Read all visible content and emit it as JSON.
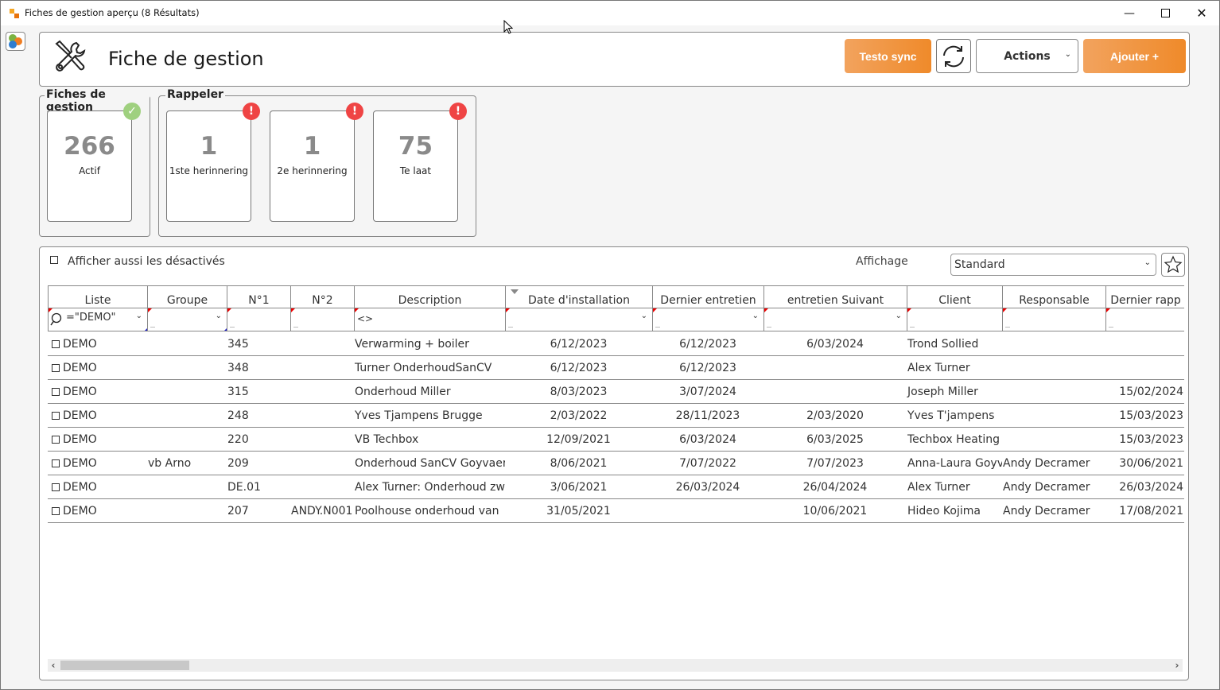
{
  "window": {
    "title": "Fiches de gestion aperçu (8 Résultats)",
    "controls": {
      "minimize": "—",
      "maximize": "☐",
      "close": "✕"
    }
  },
  "header": {
    "icon": "tools-icon",
    "title": "Fiche de gestion",
    "buttons": {
      "testo_sync": "Testo sync",
      "refresh": "refresh-icon",
      "actions": "Actions",
      "add": "Ajouter +"
    }
  },
  "colors": {
    "accent_orange": "#ef8a2a",
    "badge_ok": "#9fd07f",
    "badge_alert": "#ef4444",
    "filter_mark": "#e00000"
  },
  "stats": {
    "fiches": {
      "title": "Fiches de gestion",
      "cards": [
        {
          "value": "266",
          "label": "Actif",
          "badge": "check"
        }
      ]
    },
    "rappeler": {
      "title": "Rappeler",
      "cards": [
        {
          "value": "1",
          "label": "1ste herinnering",
          "badge": "!"
        },
        {
          "value": "1",
          "label": "2e herinnering",
          "badge": "!"
        },
        {
          "value": "75",
          "label": "Te laat",
          "badge": "!"
        }
      ]
    }
  },
  "list": {
    "show_disabled_label": "Afficher aussi les désactivés",
    "show_disabled_checked": false,
    "affichage_label": "Affichage",
    "affichage_value": "Standard",
    "columns": [
      {
        "label": "Liste",
        "filter": "=\"DEMO\"",
        "filter_type": "search-select"
      },
      {
        "label": "Groupe",
        "filter": "",
        "filter_type": "select"
      },
      {
        "label": "N°1",
        "filter": "",
        "filter_type": "text"
      },
      {
        "label": "N°2",
        "filter": "",
        "filter_type": "text"
      },
      {
        "label": "Description",
        "filter": "<>",
        "filter_type": "text"
      },
      {
        "label": "Date d'installation",
        "filter": "",
        "filter_type": "select",
        "sorted": "desc"
      },
      {
        "label": "Dernier entretien",
        "filter": "",
        "filter_type": "select"
      },
      {
        "label": "entretien Suivant",
        "filter": "",
        "filter_type": "select"
      },
      {
        "label": "Client",
        "filter": "",
        "filter_type": "text"
      },
      {
        "label": "Responsable",
        "filter": "",
        "filter_type": "text"
      },
      {
        "label": "Dernier rapp",
        "filter": "",
        "filter_type": "text"
      }
    ],
    "rows": [
      [
        "DEMO",
        "",
        "345",
        "",
        "Verwarming + boiler",
        "6/12/2023",
        "6/12/2023",
        "6/03/2024",
        "Trond Sollied",
        "",
        ""
      ],
      [
        "DEMO",
        "",
        "348",
        "",
        "Turner OnderhoudSanCV",
        "6/12/2023",
        "6/12/2023",
        "",
        "Alex Turner",
        "",
        ""
      ],
      [
        "DEMO",
        "",
        "315",
        "",
        "Onderhoud Miller",
        "8/03/2023",
        "3/07/2024",
        "",
        "Joseph Miller",
        "",
        "15/02/2024"
      ],
      [
        "DEMO",
        "",
        "248",
        "",
        "Yves Tjampens Brugge",
        "2/03/2022",
        "28/11/2023",
        "2/03/2020",
        "Yves T'jampens",
        "",
        "15/03/2023"
      ],
      [
        "DEMO",
        "",
        "220",
        "",
        "VB Techbox",
        "12/09/2021",
        "6/03/2024",
        "6/03/2025",
        "Techbox Heating",
        "",
        "15/03/2023"
      ],
      [
        "DEMO",
        "vb Arno",
        "209",
        "",
        "Onderhoud SanCV Goyvaer",
        "8/06/2021",
        "7/07/2022",
        "7/07/2023",
        "Anna-Laura Goyv",
        "Andy Decramer",
        "30/06/2021"
      ],
      [
        "DEMO",
        "",
        "DE.01",
        "",
        "Alex Turner: Onderhoud zw",
        "3/06/2021",
        "26/03/2024",
        "26/04/2024",
        "Alex Turner",
        "Andy Decramer",
        "26/03/2024"
      ],
      [
        "DEMO",
        "",
        "207",
        "ANDY.N001",
        "Poolhouse onderhoud van",
        "31/05/2021",
        "",
        "10/06/2021",
        "Hideo Kojima",
        "Andy Decramer",
        "17/08/2021"
      ]
    ]
  }
}
